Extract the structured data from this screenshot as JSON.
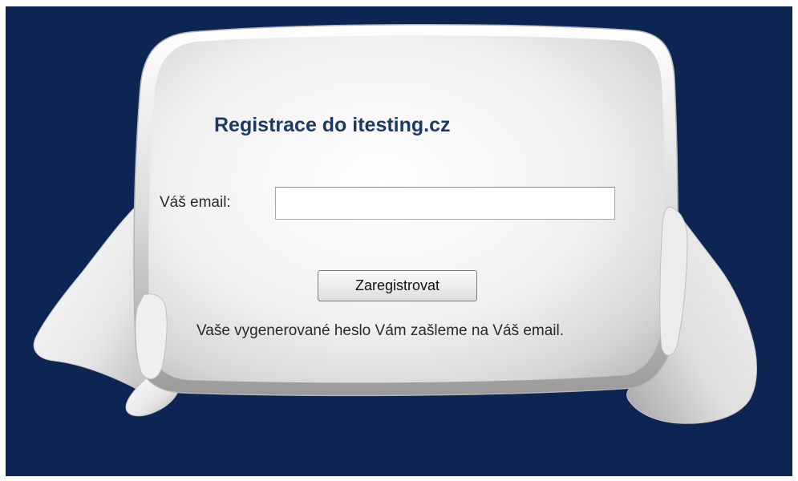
{
  "form": {
    "title": "Registrace do itesting.cz",
    "email_label": "Váš email:",
    "email_value": "",
    "email_placeholder": "",
    "submit_label": "Zaregistrovat",
    "info_text": "Vaše vygenerované heslo Vám zašleme na Váš email."
  },
  "theme": {
    "background": "#0d2552",
    "title_color": "#1b3a66"
  }
}
